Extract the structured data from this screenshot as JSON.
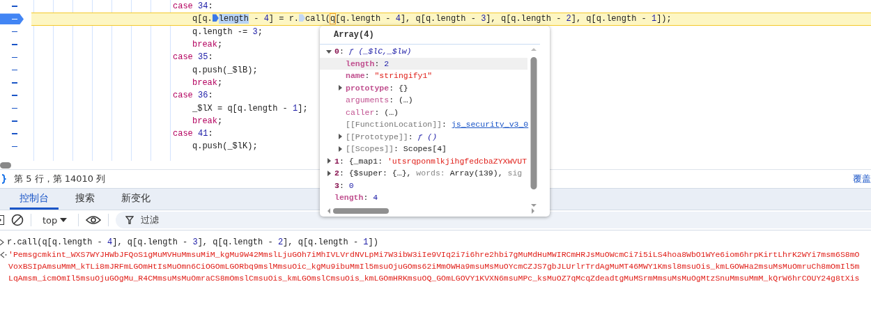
{
  "code_lines": [
    {
      "kind": "case",
      "current": false,
      "tokens": [
        {
          "kind": "keyword",
          "text": "case"
        },
        {
          "kind": "number",
          "text": " 34"
        },
        {
          "kind": "plain",
          "text": ":"
        }
      ]
    },
    {
      "kind": "body",
      "current": true,
      "tokens": [
        {
          "kind": "plain",
          "text": "q[q."
        },
        {
          "kind": "marker",
          "active": true
        },
        {
          "kind": "selected",
          "text": "length"
        },
        {
          "kind": "plain",
          "text": " - "
        },
        {
          "kind": "number",
          "text": "4"
        },
        {
          "kind": "plain",
          "text": "] = r."
        },
        {
          "kind": "marker",
          "active": false
        },
        {
          "kind": "plain",
          "text": "call("
        },
        {
          "kind": "hovered",
          "text": "q"
        },
        {
          "kind": "plain",
          "text": "[q.length - "
        },
        {
          "kind": "number",
          "text": "4"
        },
        {
          "kind": "plain",
          "text": "], q[q.length - "
        },
        {
          "kind": "number",
          "text": "3"
        },
        {
          "kind": "plain",
          "text": "], q[q.length - "
        },
        {
          "kind": "number",
          "text": "2"
        },
        {
          "kind": "plain",
          "text": "], q[q.length - "
        },
        {
          "kind": "number",
          "text": "1"
        },
        {
          "kind": "plain",
          "text": "]);"
        }
      ]
    },
    {
      "kind": "body",
      "current": false,
      "tokens": [
        {
          "kind": "plain",
          "text": "q.length -= "
        },
        {
          "kind": "number",
          "text": "3"
        },
        {
          "kind": "plain",
          "text": ";"
        }
      ]
    },
    {
      "kind": "body",
      "current": false,
      "tokens": [
        {
          "kind": "keyword",
          "text": "break"
        },
        {
          "kind": "plain",
          "text": ";"
        }
      ]
    },
    {
      "kind": "case",
      "current": false,
      "tokens": [
        {
          "kind": "keyword",
          "text": "case"
        },
        {
          "kind": "number",
          "text": " 35"
        },
        {
          "kind": "plain",
          "text": ":"
        }
      ]
    },
    {
      "kind": "body",
      "current": false,
      "tokens": [
        {
          "kind": "plain",
          "text": "q.push(_$lB);"
        }
      ]
    },
    {
      "kind": "body",
      "current": false,
      "tokens": [
        {
          "kind": "keyword",
          "text": "break"
        },
        {
          "kind": "plain",
          "text": ";"
        }
      ]
    },
    {
      "kind": "case",
      "current": false,
      "tokens": [
        {
          "kind": "keyword",
          "text": "case"
        },
        {
          "kind": "number",
          "text": " 36"
        },
        {
          "kind": "plain",
          "text": ":"
        }
      ]
    },
    {
      "kind": "body",
      "current": false,
      "tokens": [
        {
          "kind": "plain",
          "text": "_$lX = q[q.length - "
        },
        {
          "kind": "number",
          "text": "1"
        },
        {
          "kind": "plain",
          "text": "];"
        }
      ]
    },
    {
      "kind": "body",
      "current": false,
      "tokens": [
        {
          "kind": "keyword",
          "text": "break"
        },
        {
          "kind": "plain",
          "text": ";"
        }
      ]
    },
    {
      "kind": "case",
      "current": false,
      "tokens": [
        {
          "kind": "keyword",
          "text": "case"
        },
        {
          "kind": "number",
          "text": " 41"
        },
        {
          "kind": "plain",
          "text": ":"
        }
      ]
    },
    {
      "kind": "body",
      "current": false,
      "tokens": [
        {
          "kind": "plain",
          "text": "q.push(_$lK);"
        }
      ]
    }
  ],
  "popover": {
    "title": "Array(4)",
    "separator": ":",
    "rows": [
      {
        "key": "0",
        "kind": "index",
        "expanded": true,
        "highlighted": false,
        "value": [
          {
            "kind": "fn",
            "text": "ƒ (_$lC,_$lw)"
          }
        ],
        "children": [
          {
            "key": "length",
            "kind": "prop",
            "highlighted": true,
            "value": [
              {
                "kind": "number",
                "text": "2"
              }
            ]
          },
          {
            "key": "name",
            "kind": "prop",
            "highlighted": false,
            "value": [
              {
                "kind": "string",
                "text": "\"stringify1\""
              }
            ]
          },
          {
            "key": "prototype",
            "kind": "prop",
            "expanded": false,
            "highlighted": false,
            "value": [
              {
                "kind": "plain",
                "text": "{}"
              }
            ]
          },
          {
            "key": "arguments",
            "kind": "accessor",
            "highlighted": false,
            "value": [
              {
                "kind": "plain",
                "text": "(…)"
              }
            ]
          },
          {
            "key": "caller",
            "kind": "accessor",
            "highlighted": false,
            "value": [
              {
                "kind": "plain",
                "text": "(…)"
              }
            ]
          },
          {
            "key": "[[FunctionLocation]]",
            "kind": "internal",
            "highlighted": false,
            "value": [
              {
                "kind": "link",
                "text": "js_security_v3_0"
              }
            ]
          },
          {
            "key": "[[Prototype]]",
            "kind": "internal",
            "expanded": false,
            "highlighted": false,
            "value": [
              {
                "kind": "fn",
                "text": "ƒ ()"
              }
            ]
          },
          {
            "key": "[[Scopes]]",
            "kind": "internal",
            "expanded": false,
            "highlighted": false,
            "value": [
              {
                "kind": "plain",
                "text": "Scopes[4]"
              }
            ]
          }
        ]
      },
      {
        "key": "1",
        "kind": "index",
        "expanded": false,
        "highlighted": false,
        "value": [
          {
            "kind": "plain",
            "text": "{_map1: "
          },
          {
            "kind": "string",
            "text": "'utsrqponmlkjihgfedcbaZYXWVUT"
          }
        ]
      },
      {
        "key": "2",
        "kind": "index",
        "expanded": false,
        "highlighted": false,
        "value": [
          {
            "kind": "plain",
            "text": "{$super: {…}, "
          },
          {
            "kind": "dim",
            "text": "words: "
          },
          {
            "kind": "plain",
            "text": "Array(139), "
          },
          {
            "kind": "dim",
            "text": "sig"
          }
        ]
      },
      {
        "key": "3",
        "kind": "index",
        "highlighted": false,
        "value": [
          {
            "kind": "number",
            "text": "0"
          }
        ]
      },
      {
        "key": "length",
        "kind": "prop",
        "highlighted": false,
        "value": [
          {
            "kind": "number",
            "text": "4"
          }
        ]
      }
    ]
  },
  "status_bar": {
    "position": "第 5 行，第 14010 列",
    "right_tab": "覆盖"
  },
  "drawer_tabs": [
    {
      "label": "控制台",
      "selected": true
    },
    {
      "label": "搜索",
      "selected": false
    },
    {
      "label": "新变化",
      "selected": false
    }
  ],
  "console_toolbar": {
    "context": "top",
    "filter_placeholder": "过滤"
  },
  "console": {
    "input": [
      {
        "kind": "plain",
        "text": "r.call(q[q.length - "
      },
      {
        "kind": "number",
        "text": "4"
      },
      {
        "kind": "plain",
        "text": "], q[q.length - "
      },
      {
        "kind": "number",
        "text": "3"
      },
      {
        "kind": "plain",
        "text": "], q[q.length - "
      },
      {
        "kind": "number",
        "text": "2"
      },
      {
        "kind": "plain",
        "text": "], q[q.length - "
      },
      {
        "kind": "number",
        "text": "1"
      },
      {
        "kind": "plain",
        "text": "])"
      }
    ],
    "output_lines": [
      "'Pemsgcmkint_WXS7WYJHWbJFQoS1gMuMVHuMmsuMiM_kgMu9W42MmslLjuGOh7iMhIVLVrdNVLpMi7W3ibW3iIe9VIq2i7i6hre2hbi7gMuMdHuMWIRCmHRJsMuOWcmCi7i5iLS4hoa8WbO1WYe6iom6hrpKirtLhrK2WYi7msm6S8mO",
      "VoxBSIpAmsuMmM_kTLi8mJRFmLGOmHtIsMuOmn6CiOGOmLGORbq9mslMmsuOic_kgMu9ibuMmIl5msuOjuGOms62iMmOWHa9msuMsMuOYcmCZJS7gbJLUrlrTrdAgMuMT46MWY1Kmsl8msuOis_kmLGOWHa2msuMsMuOmruCh8mOmIl5m",
      "LqAmsm_icmOmIl5msuOjuGOgMu_R4CMmsuMsMuOmraCS8mOmslCmsuOis_kmLGOmslCmsuOis_kmLGOmHRKmsuOQ_GOmLGOVY1KVXN6msuMPc_ksMuOZ7qMcqZdeadtgMuMSrmMmsuMsMuOgMtzSnuMmsuMmM_kQrW6hrCOUY24g8tXis"
    ]
  }
}
